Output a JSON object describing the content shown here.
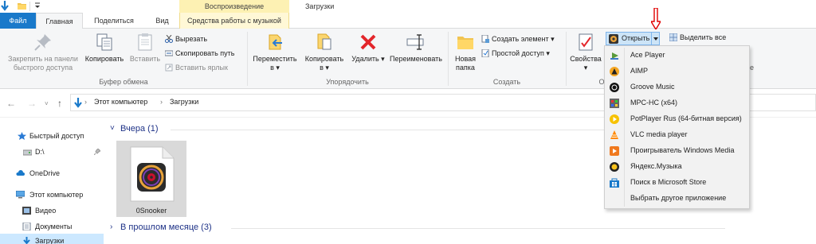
{
  "window": {
    "title": "Загрузки",
    "contextual_group": "Воспроизведение"
  },
  "tabs": {
    "file": "Файл",
    "home": "Главная",
    "share": "Поделиться",
    "view": "Вид",
    "music_tools": "Средства работы с музыкой"
  },
  "ribbon": {
    "clipboard": {
      "label": "Буфер обмена",
      "pin": "Закрепить на панели\nбыстрого доступа",
      "copy": "Копировать",
      "paste": "Вставить",
      "cut": "Вырезать",
      "copy_path": "Скопировать путь",
      "paste_shortcut": "Вставить ярлык"
    },
    "organize": {
      "label": "Упорядочить",
      "move_to": "Переместить\nв ▾",
      "copy_to": "Копировать\nв ▾",
      "delete": "Удалить ▾",
      "rename": "Переименовать"
    },
    "create": {
      "label": "Создать",
      "new_folder": "Новая\nпапка",
      "new_item": "Создать элемент ▾",
      "easy_access": "Простой доступ ▾"
    },
    "open": {
      "label_partial": "О",
      "properties": "Свойства\n▾",
      "open_button": "Открыть",
      "select_all": "Выделить все",
      "hidden_partial": "е"
    }
  },
  "address": {
    "crumbs": [
      "Этот компьютер",
      "Загрузки"
    ]
  },
  "navpane": {
    "items": [
      {
        "label": "Быстрый доступ"
      },
      {
        "label": "D:\\"
      },
      {
        "label": "OneDrive"
      },
      {
        "label": "Этот компьютер"
      },
      {
        "label": "Видео"
      },
      {
        "label": "Документы"
      },
      {
        "label": "Загрузки"
      }
    ]
  },
  "content": {
    "groups": [
      {
        "header": "Вчера (1)"
      },
      {
        "header": "В прошлом месяце (3)"
      }
    ],
    "file": {
      "name": "0Snooker"
    }
  },
  "open_menu": {
    "items": [
      {
        "label": "Ace Player",
        "icon": "ace-player-icon"
      },
      {
        "label": "AIMP",
        "icon": "aimp-icon"
      },
      {
        "label": "Groove Music",
        "icon": "groove-music-icon"
      },
      {
        "label": "MPC-HC (x64)",
        "icon": "mpc-hc-icon"
      },
      {
        "label": "PotPlayer Rus (64-битная версия)",
        "icon": "potplayer-icon"
      },
      {
        "label": "VLC media player",
        "icon": "vlc-icon"
      },
      {
        "label": "Проигрыватель Windows Media",
        "icon": "windows-media-player-icon"
      },
      {
        "label": "Яндекс.Музыка",
        "icon": "yandex-music-icon"
      },
      {
        "label": "Поиск в Microsoft Store",
        "icon": "microsoft-store-icon"
      },
      {
        "label": "Выбрать другое приложение",
        "icon": ""
      }
    ]
  },
  "colors": {
    "file_tab": "#1979ca",
    "selection": "#cce8ff",
    "contextual_band": "#fdf1b3",
    "annotation_arrow": "#e00000"
  }
}
